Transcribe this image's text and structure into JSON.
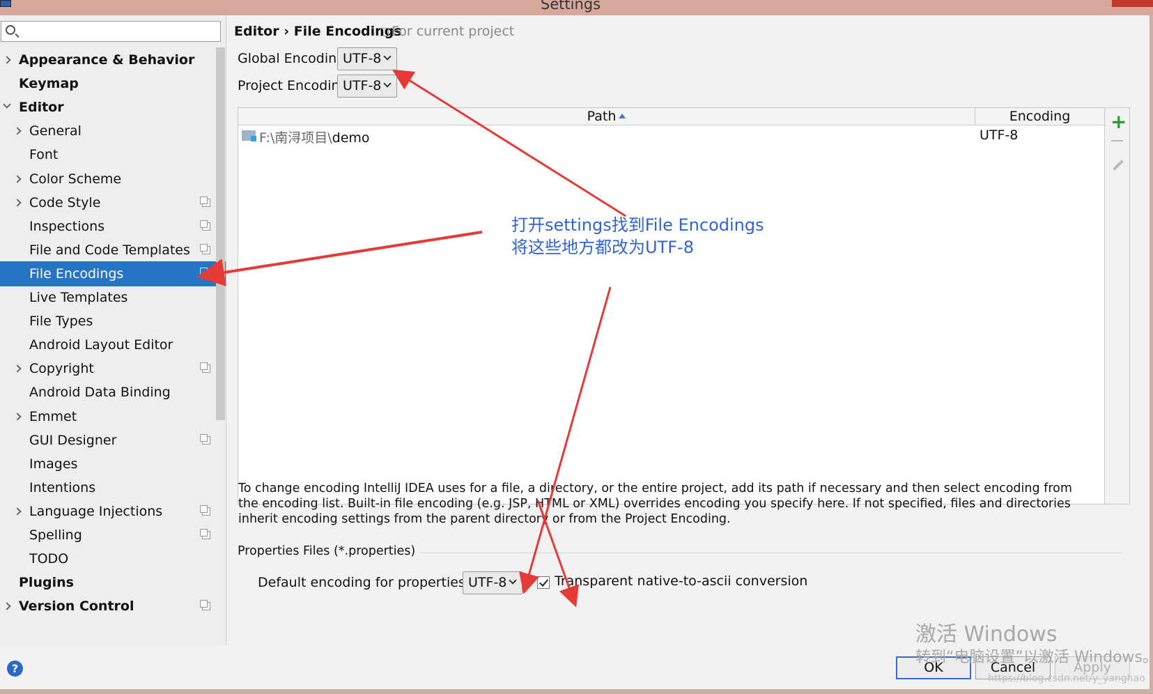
{
  "window": {
    "title": "Settings"
  },
  "search": {
    "placeholder": ""
  },
  "sidebar": {
    "items": [
      {
        "label": "Appearance & Behavior",
        "level": 0,
        "bold": true,
        "chevron": "collapsed",
        "project_icon": false
      },
      {
        "label": "Keymap",
        "level": 0,
        "bold": true,
        "chevron": "none",
        "project_icon": false
      },
      {
        "label": "Editor",
        "level": 0,
        "bold": true,
        "chevron": "expanded",
        "project_icon": false
      },
      {
        "label": "General",
        "level": 1,
        "bold": false,
        "chevron": "collapsed",
        "project_icon": false
      },
      {
        "label": "Font",
        "level": 1,
        "bold": false,
        "chevron": "none",
        "project_icon": false
      },
      {
        "label": "Color Scheme",
        "level": 1,
        "bold": false,
        "chevron": "collapsed",
        "project_icon": false
      },
      {
        "label": "Code Style",
        "level": 1,
        "bold": false,
        "chevron": "collapsed",
        "project_icon": true
      },
      {
        "label": "Inspections",
        "level": 1,
        "bold": false,
        "chevron": "none",
        "project_icon": true
      },
      {
        "label": "File and Code Templates",
        "level": 1,
        "bold": false,
        "chevron": "none",
        "project_icon": true
      },
      {
        "label": "File Encodings",
        "level": 1,
        "bold": false,
        "chevron": "none",
        "project_icon": true,
        "selected": true
      },
      {
        "label": "Live Templates",
        "level": 1,
        "bold": false,
        "chevron": "none",
        "project_icon": false
      },
      {
        "label": "File Types",
        "level": 1,
        "bold": false,
        "chevron": "none",
        "project_icon": false
      },
      {
        "label": "Android Layout Editor",
        "level": 1,
        "bold": false,
        "chevron": "none",
        "project_icon": false
      },
      {
        "label": "Copyright",
        "level": 1,
        "bold": false,
        "chevron": "collapsed",
        "project_icon": true
      },
      {
        "label": "Android Data Binding",
        "level": 1,
        "bold": false,
        "chevron": "none",
        "project_icon": false
      },
      {
        "label": "Emmet",
        "level": 1,
        "bold": false,
        "chevron": "collapsed",
        "project_icon": false
      },
      {
        "label": "GUI Designer",
        "level": 1,
        "bold": false,
        "chevron": "none",
        "project_icon": true
      },
      {
        "label": "Images",
        "level": 1,
        "bold": false,
        "chevron": "none",
        "project_icon": false
      },
      {
        "label": "Intentions",
        "level": 1,
        "bold": false,
        "chevron": "none",
        "project_icon": false
      },
      {
        "label": "Language Injections",
        "level": 1,
        "bold": false,
        "chevron": "collapsed",
        "project_icon": true
      },
      {
        "label": "Spelling",
        "level": 1,
        "bold": false,
        "chevron": "none",
        "project_icon": true
      },
      {
        "label": "TODO",
        "level": 1,
        "bold": false,
        "chevron": "none",
        "project_icon": false
      },
      {
        "label": "Plugins",
        "level": 0,
        "bold": true,
        "chevron": "none",
        "project_icon": false
      },
      {
        "label": "Version Control",
        "level": 0,
        "bold": true,
        "chevron": "collapsed",
        "project_icon": true
      }
    ]
  },
  "breadcrumb": {
    "parent": "Editor",
    "separator": "›",
    "current": "File Encodings",
    "scope": "For current project"
  },
  "encodings": {
    "global_label": "Global Encoding:",
    "global_value": "UTF-8",
    "project_label": "Project Encoding:",
    "project_value": "UTF-8"
  },
  "table": {
    "columns": [
      "Path",
      "Encoding"
    ],
    "sorted_column": "Path",
    "rows": [
      {
        "path_prefix": "F:\\南浔项目\\",
        "path_name": "demo",
        "encoding": "UTF-8"
      }
    ],
    "toolbar_icons": [
      "add-icon",
      "remove-icon",
      "edit-icon"
    ]
  },
  "help_text": "To change encoding IntelliJ IDEA uses for a file, a directory, or the entire project, add its path if necessary and then select encoding from the encoding list. Built-in file encoding (e.g. JSP, HTML or XML) overrides encoding you specify here. If not specified, files and directories inherit encoding settings from the parent directory or from the Project Encoding.",
  "properties": {
    "section_title": "Properties Files (*.properties)",
    "default_label": "Default encoding for properties files:",
    "default_value": "UTF-8",
    "transparent_label": "Transparent native-to-ascii conversion",
    "transparent_checked": true
  },
  "buttons": {
    "ok": "OK",
    "cancel": "Cancel",
    "apply": "Apply",
    "help": "?"
  },
  "annotation": {
    "line1": "打开settings找到File Encodings",
    "line2": "将这些地方都改为UTF-8",
    "color": "#2f63d6",
    "arrow_color": "#e53a36"
  },
  "watermark": {
    "line1": "激活 Windows",
    "line2": "转到“电脑设置”以激活 Windows。",
    "url": "https://blog.csdn.net/y_yanghao"
  },
  "colors": {
    "selection": "#2675c4",
    "add_icon": "#2c9a3c",
    "help_icon": "#2769c5"
  }
}
